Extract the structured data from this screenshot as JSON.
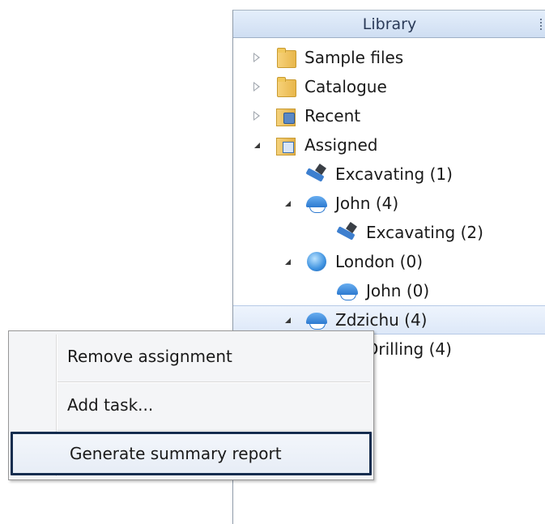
{
  "library": {
    "title": "Library",
    "items": [
      {
        "label": "Sample files",
        "icon": "folder-icon",
        "expander": "collapsed"
      },
      {
        "label": "Catalogue",
        "icon": "folder-icon",
        "expander": "collapsed"
      },
      {
        "label": "Recent",
        "icon": "recent-folder-icon",
        "expander": "collapsed"
      },
      {
        "label": "Assigned",
        "icon": "assigned-folder-icon",
        "expander": "expanded"
      },
      {
        "label": "Excavating (1)",
        "icon": "drill-icon",
        "expander": "none"
      },
      {
        "label": "John (4)",
        "icon": "person-icon",
        "expander": "expanded"
      },
      {
        "label": "Excavating (2)",
        "icon": "drill-icon",
        "expander": "none"
      },
      {
        "label": "London (0)",
        "icon": "globe-icon",
        "expander": "expanded"
      },
      {
        "label": "John (0)",
        "icon": "person-icon",
        "expander": "none"
      },
      {
        "label": "Zdzichu (4)",
        "icon": "person-icon",
        "expander": "expanded",
        "selected": true
      },
      {
        "label": "Drilling (4)",
        "icon": "drill-icon",
        "expander": "none"
      }
    ]
  },
  "context_menu": {
    "items": [
      {
        "label": "Remove assignment"
      },
      {
        "label": "Add task..."
      },
      {
        "label": "Generate summary report",
        "highlighted": true
      }
    ]
  }
}
